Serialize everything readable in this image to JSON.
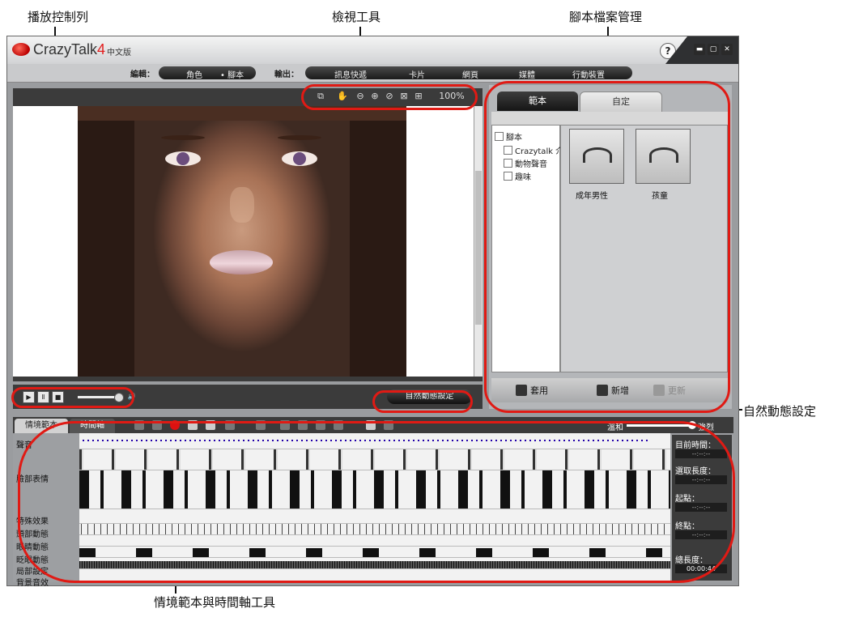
{
  "callouts": {
    "playback": "播放控制列",
    "view_tools": "檢視工具",
    "script_mgmt": "腳本檔案管理",
    "auto_motion": "自然動態設定",
    "timeline_tools": "情境範本與時間軸工具"
  },
  "app": {
    "logo_name": "CrazyTalk",
    "logo_version": "4",
    "logo_sub": "中文版",
    "help": "?",
    "colors": {
      "accent_red": "#e01a14",
      "window_gray": "#9a9c9f",
      "panel_dark": "#3b3b3b"
    }
  },
  "menubar": {
    "edit_label": "編輯：",
    "edit_items": [
      "角色",
      "• 腳本"
    ],
    "output_label": "輸出：",
    "output_items": [
      "訊息快遞",
      "卡片",
      "網頁",
      "媒體",
      "行動裝置"
    ]
  },
  "viewer": {
    "zoom": "100%",
    "tool_icons": [
      "fit-window-icon",
      "hand-pan-icon",
      "zoom-out-icon",
      "zoom-in-icon",
      "reset-icon",
      "frame-icon",
      "zoom-region-icon"
    ]
  },
  "player": {
    "icons": [
      "play-icon",
      "pause-icon",
      "stop-icon",
      "volume-icon"
    ],
    "auto_motion_button": "自然動態設定"
  },
  "script_panel": {
    "tabs": [
      "範本",
      "自定"
    ],
    "tree": [
      {
        "label": "腳本"
      },
      {
        "label": "Crazytalk 介"
      },
      {
        "label": "動物聲音"
      },
      {
        "label": "趣味"
      }
    ],
    "thumbnails": [
      {
        "label": "成年男性"
      },
      {
        "label": "孩童"
      }
    ],
    "bottom_buttons": [
      "套用",
      "新增",
      "更新"
    ]
  },
  "timeline": {
    "tabs": [
      "情境範本",
      "時間軸"
    ],
    "strength_left": "溫和",
    "strength_right": "強烈",
    "tracks": [
      "聲音",
      "臉部表情",
      "特殊效果",
      "頭部動態",
      "眼睛動態",
      "眨眼動態",
      "局部設定",
      "背景音效"
    ],
    "info": [
      {
        "label": "目前時間：",
        "value": "--:--:--"
      },
      {
        "label": "選取長度：",
        "value": "--:--:--"
      },
      {
        "label": "起點：",
        "value": "--:--:--"
      },
      {
        "label": "終點：",
        "value": "--:--:--"
      },
      {
        "label": "總長度：",
        "value": "00:00:44"
      }
    ]
  }
}
